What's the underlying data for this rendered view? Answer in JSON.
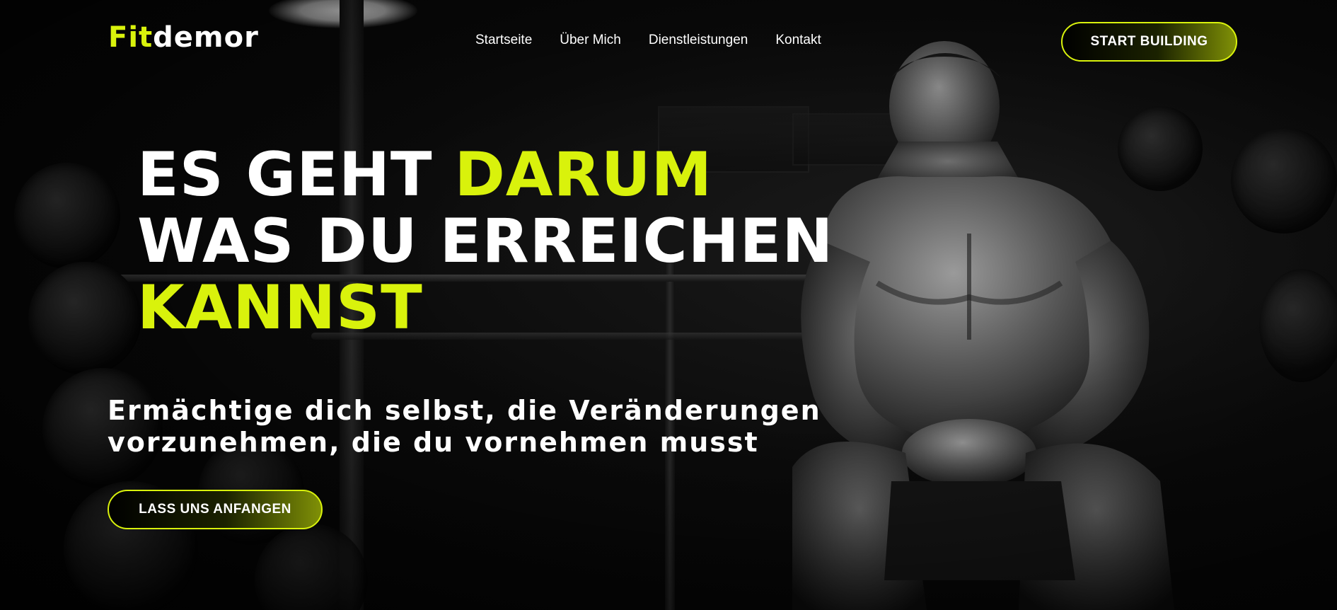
{
  "brand": {
    "logo_part1": "Fit",
    "logo_part2": "demor",
    "accent_color": "#d9f20c"
  },
  "nav": {
    "items": [
      {
        "label": "Startseite"
      },
      {
        "label": "Über Mich"
      },
      {
        "label": "Dienstleistungen"
      },
      {
        "label": "Kontakt"
      }
    ]
  },
  "header": {
    "cta_label": "START BUILDING"
  },
  "hero": {
    "line1_white": "ES GEHT ",
    "line1_accent": "DARUM",
    "line2_white": "WAS DU ERREICHEN",
    "line3_accent": "KANNST",
    "subheadline": "Ermächtige dich selbst, die Veränderungen vorzunehmen, die du vornehmen musst",
    "cta_label": "LASS UNS ANFANGEN"
  },
  "background": {
    "image_subject": "muscular-athlete-sitting-in-dark-gym",
    "base_color": "#050505"
  }
}
